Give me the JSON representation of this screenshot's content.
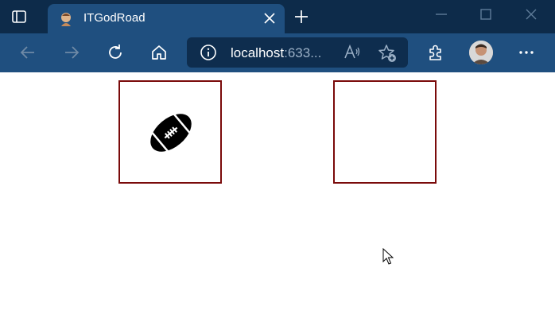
{
  "browser": {
    "tab": {
      "title": "ITGodRoad",
      "favicon": "itgodroad-favicon-icon"
    },
    "address_bar": {
      "host": "localhost",
      "port": ":633..."
    },
    "colors": {
      "titlebar": "#0d2b4a",
      "toolbar": "#1f4f7f",
      "address_bar": "#0e2d4e"
    },
    "icons": [
      "tab-actions-icon",
      "close-icon",
      "plus-icon",
      "minimize-icon",
      "maximize-icon",
      "window-close-icon",
      "back-arrow-icon",
      "forward-arrow-icon",
      "refresh-icon",
      "home-icon",
      "info-icon",
      "read-aloud-icon",
      "favorites-add-icon",
      "extensions-icon",
      "more-icon"
    ]
  },
  "page": {
    "boxes": [
      {
        "content_icon": "american-football-icon"
      },
      {
        "content_icon": ""
      }
    ],
    "border_color": "#7a0a0a"
  }
}
